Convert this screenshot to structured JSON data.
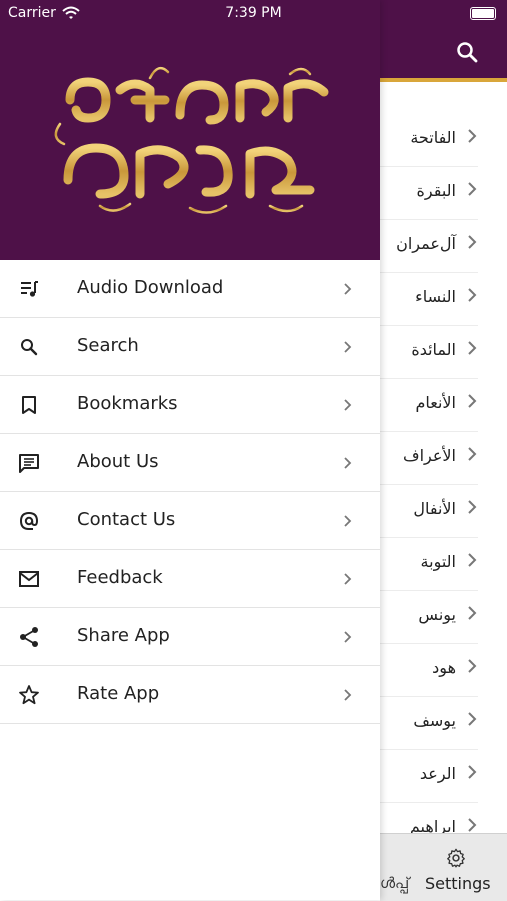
{
  "status_bar": {
    "carrier": "Carrier",
    "time": "7:39 PM"
  },
  "app": {
    "logo_alt": "തഫ്സീർ അമാനി",
    "header_color": "#4e1148",
    "accent_color": "#d9a63a"
  },
  "drawer": {
    "items": [
      {
        "label": "Audio Download",
        "icon": "playlist-music-icon"
      },
      {
        "label": "Search",
        "icon": "search-icon"
      },
      {
        "label": "Bookmarks",
        "icon": "bookmark-icon"
      },
      {
        "label": "About Us",
        "icon": "message-text-icon"
      },
      {
        "label": "Contact Us",
        "icon": "at-icon"
      },
      {
        "label": "Feedback",
        "icon": "mail-icon"
      },
      {
        "label": "Share App",
        "icon": "share-icon"
      },
      {
        "label": "Rate App",
        "icon": "star-icon"
      }
    ]
  },
  "surah_list": {
    "items": [
      "الفاتحة",
      "البقرة",
      "آل‌عمران",
      "النساء",
      "المائدة",
      "الأنعام",
      "الأعراف",
      "الأنفال",
      "التوبة",
      "يونس",
      "هود",
      "يوسف",
      "الرعد",
      "ابراهيم"
    ]
  },
  "tabbar": {
    "prev_label": "ൾപ്പ്",
    "settings_label": "Settings"
  }
}
